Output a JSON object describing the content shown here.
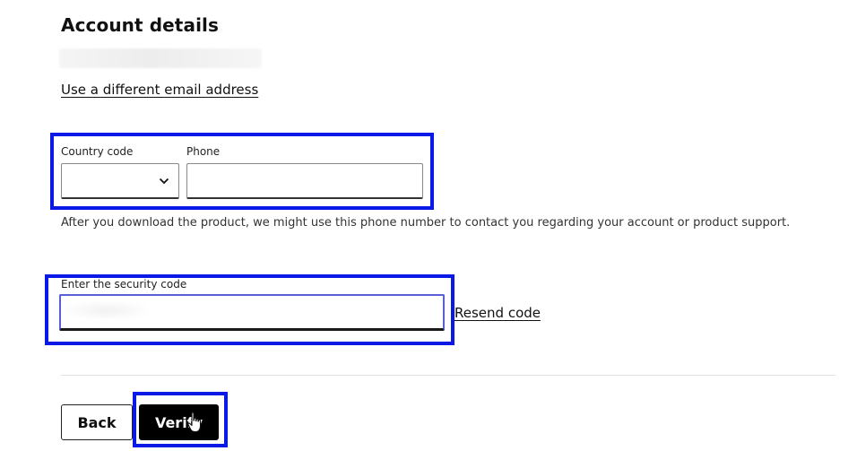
{
  "section": {
    "title": "Account details",
    "use_different_email_link": "Use a different email address"
  },
  "phone": {
    "country_code_label": "Country code",
    "country_code_value": "",
    "phone_label": "Phone",
    "phone_value": "",
    "help_text": "After you download the product, we might use this phone number to contact you regarding your account or product support."
  },
  "security": {
    "code_label": "Enter the security code",
    "code_value": "",
    "resend_link": "Resend code"
  },
  "actions": {
    "back_label": "Back",
    "verify_label": "Verify"
  },
  "icons": {
    "select_chevron": "chevron-down-icon",
    "mouse_cursor": "hand-pointer-icon"
  },
  "colors": {
    "highlight": "#0a19e6",
    "primary_button": "#000000",
    "input_focus": "#5b5fd6"
  }
}
